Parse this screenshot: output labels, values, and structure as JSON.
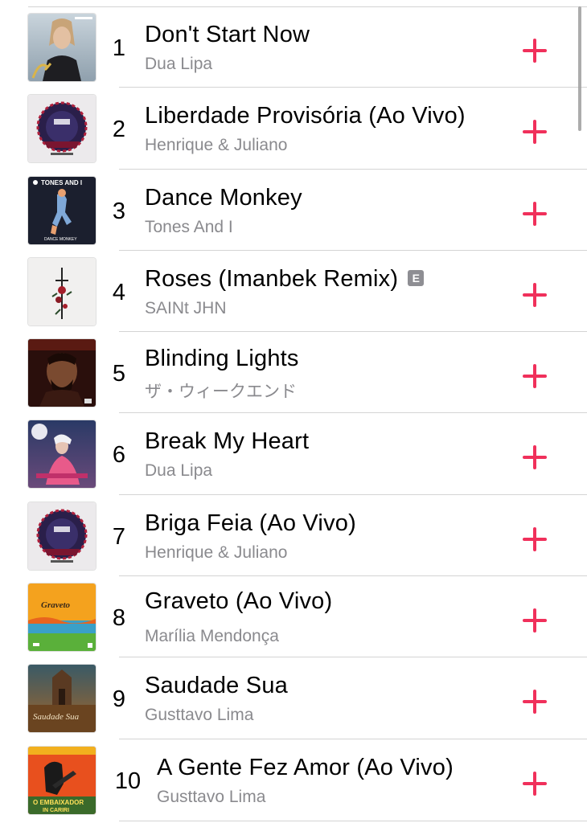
{
  "songs": [
    {
      "rank": "1",
      "title": "Don't Start Now",
      "artist": "Dua Lipa",
      "explicit": false,
      "art_icon": "album-art-dua-lipa"
    },
    {
      "rank": "2",
      "title": "Liberdade Provisória (Ao Vivo)",
      "artist": "Henrique & Juliano",
      "explicit": false,
      "art_icon": "album-art-henrique-juliano"
    },
    {
      "rank": "3",
      "title": "Dance Monkey",
      "artist": "Tones And I",
      "explicit": false,
      "art_icon": "album-art-tones-and-i"
    },
    {
      "rank": "4",
      "title": "Roses (Imanbek Remix)",
      "artist": "SAINt JHN",
      "explicit": true,
      "explicit_label": "E",
      "art_icon": "album-art-saint-jhn"
    },
    {
      "rank": "5",
      "title": "Blinding Lights",
      "artist": "ザ・ウィークエンド",
      "explicit": false,
      "art_icon": "album-art-the-weeknd"
    },
    {
      "rank": "6",
      "title": "Break My Heart",
      "artist": "Dua Lipa",
      "explicit": false,
      "art_icon": "album-art-dua-lipa-heart"
    },
    {
      "rank": "7",
      "title": "Briga Feia (Ao Vivo)",
      "artist": "Henrique & Juliano",
      "explicit": false,
      "art_icon": "album-art-henrique-juliano"
    },
    {
      "rank": "8",
      "title": "Graveto (Ao Vivo)",
      "artist": "Marília Mendonça",
      "explicit": false,
      "art_icon": "album-art-marilia-mendonca"
    },
    {
      "rank": "9",
      "title": "Saudade Sua",
      "artist": "Gusttavo Lima",
      "explicit": false,
      "art_icon": "album-art-gusttavo-lima"
    },
    {
      "rank": "10",
      "title": "A Gente Fez Amor (Ao Vivo)",
      "artist": "Gusttavo Lima",
      "explicit": false,
      "art_icon": "album-art-gusttavo-lima-embaixador"
    }
  ],
  "art_text": {
    "tones": "TONES AND I",
    "tones_sub": "DANCE MONKEY",
    "graveto": "Graveto",
    "saudade": "Saudade Sua",
    "embaixador_1": "O EMBAIXADOR",
    "embaixador_2": "IN CARIRI"
  },
  "colors": {
    "accent": "#f0305b",
    "separator": "#d4d4d4",
    "secondary_text": "#8a8a8e",
    "explicit_badge": "#8e8e93"
  },
  "icons": {
    "add": "plus-icon",
    "explicit": "explicit-badge"
  }
}
